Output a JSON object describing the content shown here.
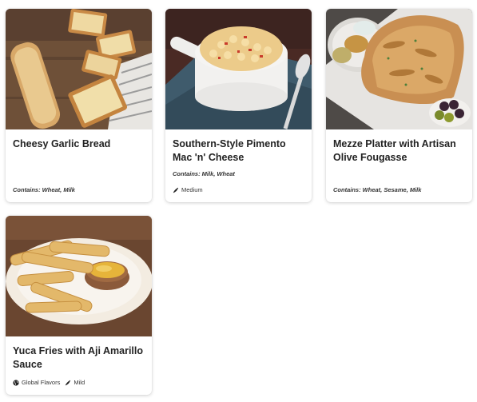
{
  "cards": [
    {
      "title": "Cheesy Garlic Bread",
      "contains": "Contains: Wheat, Milk",
      "image": "cheesy-garlic-bread-photo"
    },
    {
      "title": "Southern-Style Pimento Mac 'n' Cheese",
      "contains": "Contains: Milk, Wheat",
      "tags": [
        {
          "icon": "pepper-icon",
          "label": "Medium"
        }
      ],
      "image": "pimento-mac-n-cheese-photo"
    },
    {
      "title": "Mezze Platter with Artisan Olive Fougasse",
      "contains": "Contains: Wheat, Sesame, Milk",
      "image": "mezze-platter-photo"
    },
    {
      "title": "Yuca Fries with Aji Amarillo Sauce",
      "tags": [
        {
          "icon": "globe-icon",
          "label": "Global Flavors"
        },
        {
          "icon": "pepper-icon",
          "label": "Mild"
        }
      ],
      "image": "yuca-fries-photo"
    }
  ]
}
